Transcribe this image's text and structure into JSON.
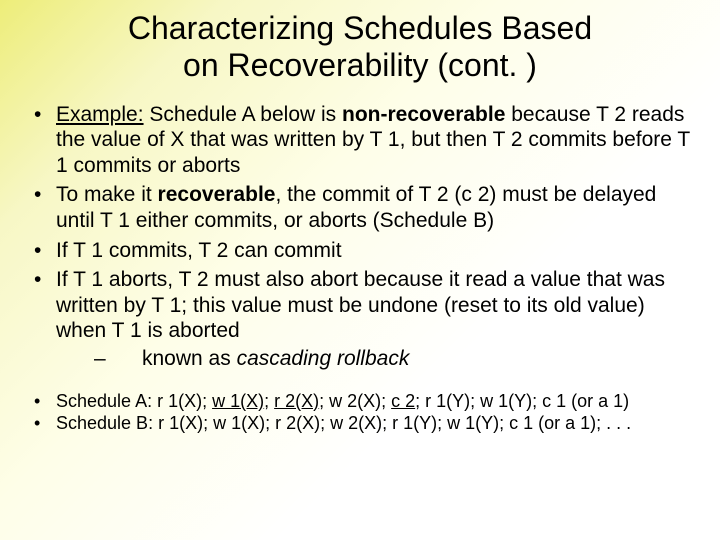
{
  "title_line1": "Characterizing Schedules Based",
  "title_line2": "on Recoverability (cont. )",
  "bullets": {
    "b1": {
      "label": "Example:",
      "pre": " Schedule A below is ",
      "bold1": "non-recoverable",
      "post": " because T 2 reads the value of X that was written by T 1, but then T 2 commits before T 1 commits or aborts"
    },
    "b2": {
      "pre": "To make it ",
      "bold1": "recoverable",
      "post": ", the commit of T 2 (c 2) must be delayed until T 1 either commits, or aborts (Schedule B)"
    },
    "b3": "If T 1 commits, T 2 can commit",
    "b4": "If T 1 aborts, T 2 must also abort because it read a value that was written by T 1; this value must be undone (reset to its old value) when T 1 is aborted",
    "sub1": {
      "pre": "known as ",
      "it": "cascading rollback"
    }
  },
  "schedules": {
    "sa": {
      "pre": "Schedule A: r 1(X); ",
      "u1": "w 1(X)",
      "mid1": "; ",
      "u2": "r 2(X)",
      "mid2": "; w 2(X); ",
      "u3": "c 2",
      "post": "; r 1(Y); w 1(Y); c 1 (or a 1)"
    },
    "sb": "Schedule B: r 1(X); w 1(X); r 2(X); w 2(X); r 1(Y); w 1(Y); c 1 (or a 1); . . ."
  }
}
